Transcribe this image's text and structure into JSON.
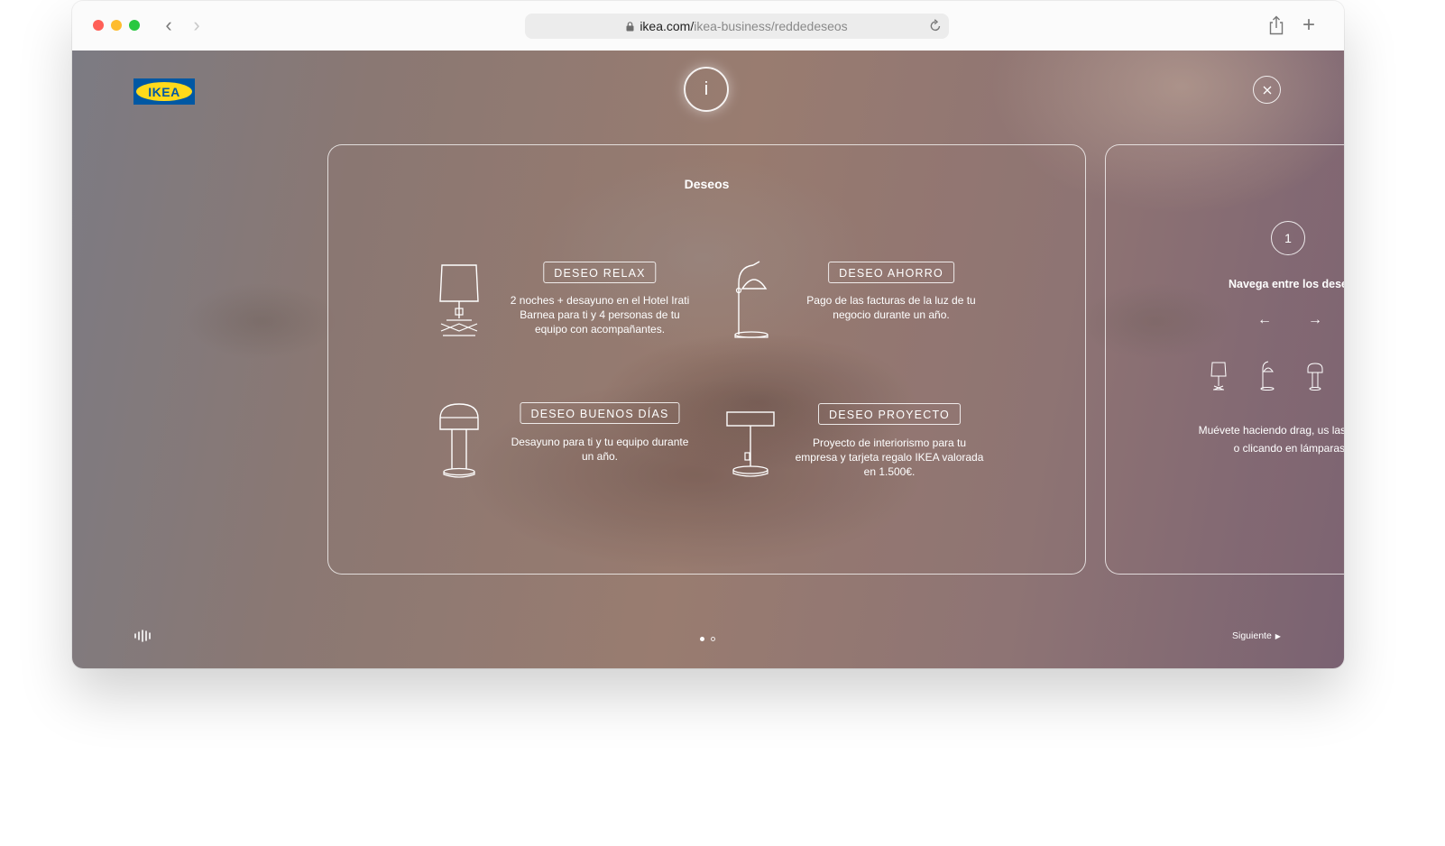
{
  "browser": {
    "url_domain": "ikea.com/",
    "url_path": "ikea-business/reddedeseos"
  },
  "header": {
    "logo_text": "IKEA",
    "info_label": "i"
  },
  "panel": {
    "title": "Deseos",
    "wishes": [
      {
        "label": "DESEO RELAX",
        "description": "2 noches + desayuno en el Hotel Irati Barnea para ti y 4 personas de tu equipo con acompañantes.",
        "icon": "table-lamp-icon"
      },
      {
        "label": "DESEO AHORRO",
        "description": "Pago de las facturas de la luz de tu negocio durante un año.",
        "icon": "desk-lamp-icon"
      },
      {
        "label": "DESEO BUENOS DÍAS",
        "description": "Desayuno para ti y tu equipo durante un año.",
        "icon": "mushroom-lamp-icon"
      },
      {
        "label": "DESEO PROYECTO",
        "description": "Proyecto de interiorismo para tu empresa y tarjeta regalo IKEA valorada en 1.500€.",
        "icon": "flat-shade-lamp-icon"
      }
    ]
  },
  "panel2": {
    "step": "1",
    "title": "Navega entre los dese",
    "arrow_left": "←",
    "arrow_right": "→",
    "description": "Muévete haciendo drag, us las flechas o clicando en lámparas."
  },
  "footer": {
    "next_label": "Siguiente",
    "next_arrow": "▶",
    "page_current": 1,
    "page_total": 2
  },
  "colors": {
    "ikea_blue": "#0058a3",
    "ikea_yellow": "#ffda1a"
  }
}
